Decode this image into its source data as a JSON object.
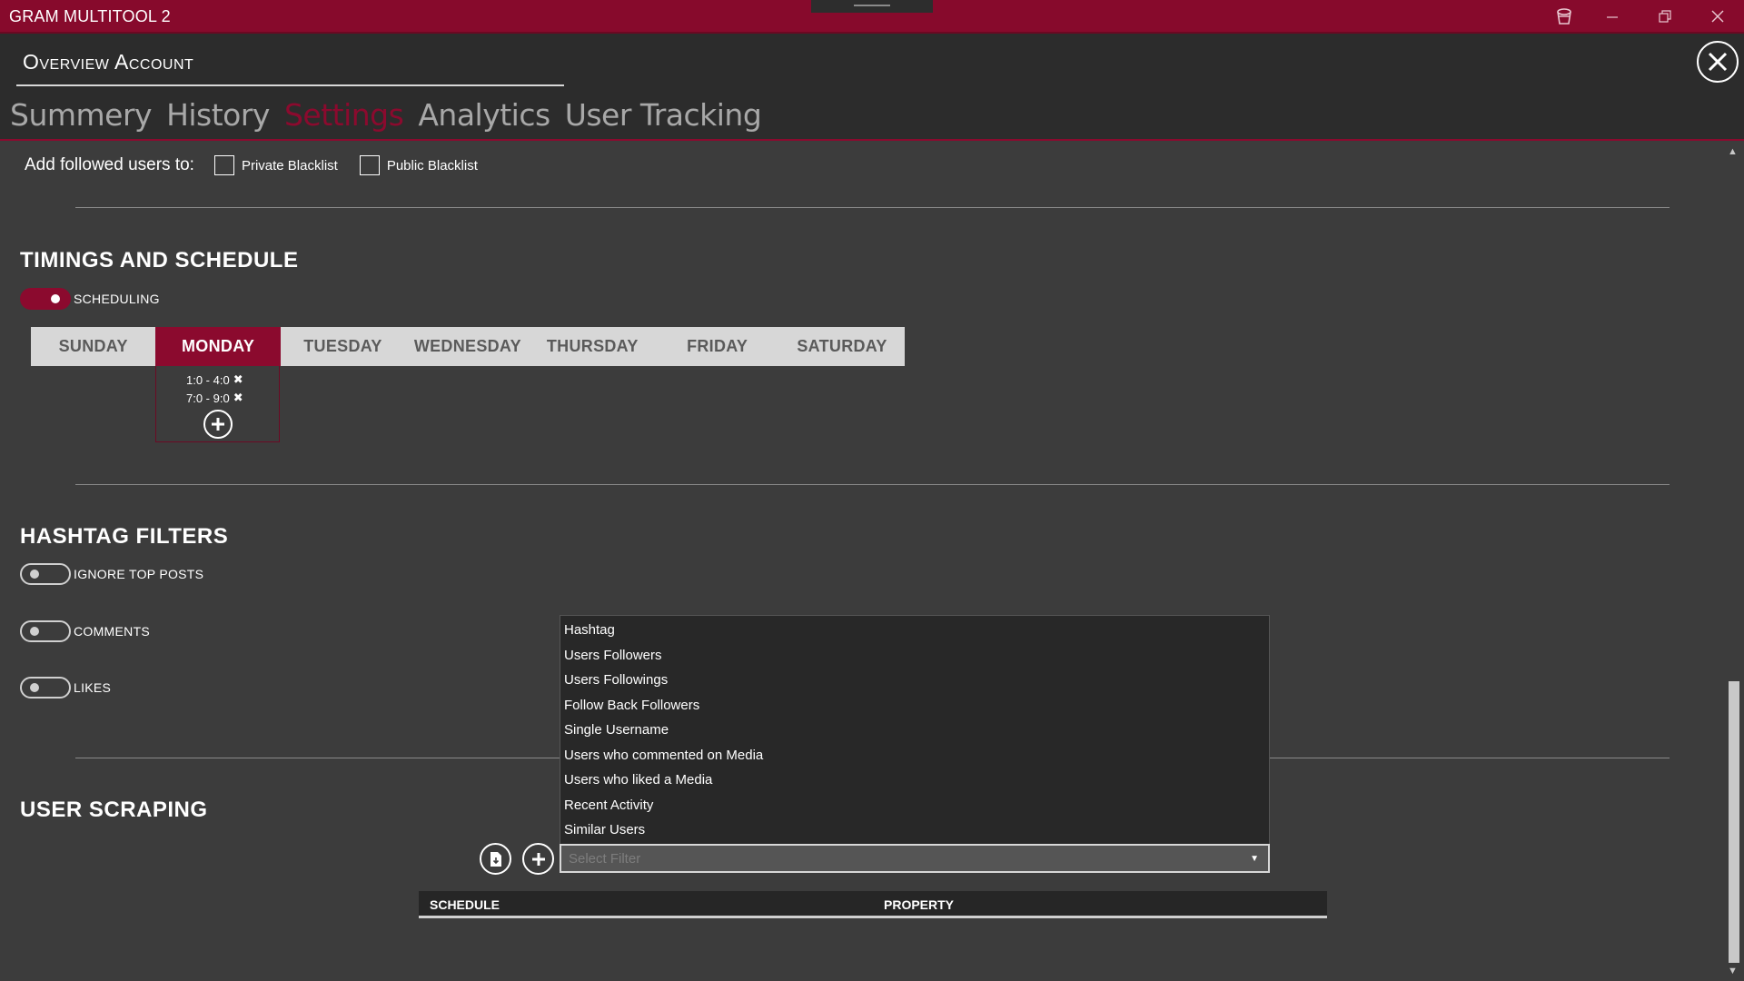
{
  "app": {
    "title": "GRAM MULTITOOL 2"
  },
  "header": {
    "title": "Overview Account",
    "tabs": [
      {
        "label": "Summery",
        "active": false
      },
      {
        "label": "History",
        "active": false
      },
      {
        "label": "Settings",
        "active": true
      },
      {
        "label": "Analytics",
        "active": false
      },
      {
        "label": "User Tracking",
        "active": false
      }
    ]
  },
  "followed": {
    "label": "Add followed users to:",
    "private_blacklist": "Private Blacklist",
    "public_blacklist": "Public Blacklist"
  },
  "timings": {
    "title": "TIMINGS AND SCHEDULE",
    "scheduling_label": "SCHEDULING",
    "scheduling_on": true,
    "days": [
      "SUNDAY",
      "MONDAY",
      "TUESDAY",
      "WEDNESDAY",
      "THURSDAY",
      "FRIDAY",
      "SATURDAY"
    ],
    "selected_day": "MONDAY",
    "slots": [
      "1:0 - 4:0",
      "7:0 - 9:0"
    ]
  },
  "hashtag": {
    "title": "HASHTAG FILTERS",
    "ignore_top_posts": "IGNORE TOP POSTS",
    "comments": "COMMENTS",
    "likes": "LIKES"
  },
  "scraping": {
    "title": "USER SCRAPING",
    "select_placeholder": "Select Filter",
    "options": [
      "Hashtag",
      "Users Followers",
      "Users Followings",
      "Follow Back Followers",
      "Single Username",
      "Users who commented on Media",
      "Users who liked a Media",
      "Recent Activity",
      "Similar Users"
    ],
    "columns": {
      "schedule": "SCHEDULE",
      "property": "PROPERTY"
    }
  },
  "colors": {
    "accent": "#8b0a2e",
    "titlebar": "#870a2c",
    "background": "#3c3c3c",
    "header_bg": "#2c2c2c"
  }
}
